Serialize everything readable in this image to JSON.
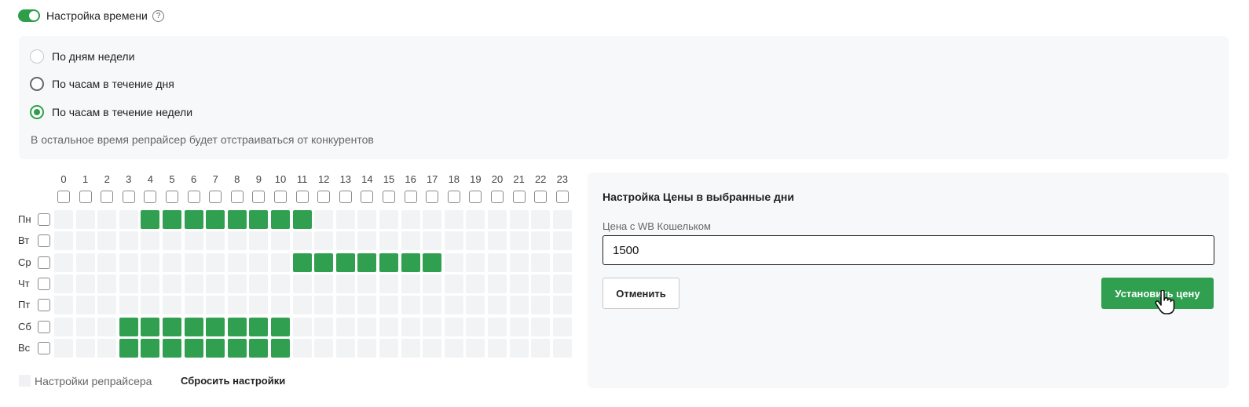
{
  "time_settings": {
    "title": "Настройка времени",
    "enabled": true,
    "help_icon": "question-icon"
  },
  "modes": [
    {
      "label": "По дням недели",
      "checked": false
    },
    {
      "label": "По часам в течение дня",
      "checked": false
    },
    {
      "label": "По часам в течение недели",
      "checked": true
    }
  ],
  "note": "В остальное время репрайсер будет отстраиваться от конкурентов",
  "schedule": {
    "hours": [
      "0",
      "1",
      "2",
      "3",
      "4",
      "5",
      "6",
      "7",
      "8",
      "9",
      "10",
      "11",
      "12",
      "13",
      "14",
      "15",
      "16",
      "17",
      "18",
      "19",
      "20",
      "21",
      "22",
      "23"
    ],
    "days": [
      {
        "label": "Пн",
        "on": [
          4,
          5,
          6,
          7,
          8,
          9,
          10,
          11
        ]
      },
      {
        "label": "Вт",
        "on": []
      },
      {
        "label": "Ср",
        "on": [
          11,
          12,
          13,
          14,
          15,
          16,
          17
        ]
      },
      {
        "label": "Чт",
        "on": []
      },
      {
        "label": "Пт",
        "on": []
      },
      {
        "label": "Сб",
        "on": [
          3,
          4,
          5,
          6,
          7,
          8,
          9,
          10
        ]
      },
      {
        "label": "Вс",
        "on": [
          3,
          4,
          5,
          6,
          7,
          8,
          9,
          10
        ]
      }
    ]
  },
  "legend": {
    "label": "Настройки репрайсера"
  },
  "reset_label": "Сбросить настройки",
  "price_panel": {
    "title": "Настройка Цены в выбранные дни",
    "field_label": "Цена с WB Кошельком",
    "field_value": "1500",
    "cancel_label": "Отменить",
    "apply_label": "Установить цену"
  },
  "colors": {
    "accent": "#30a050",
    "cell_off": "#f2f3f5"
  }
}
